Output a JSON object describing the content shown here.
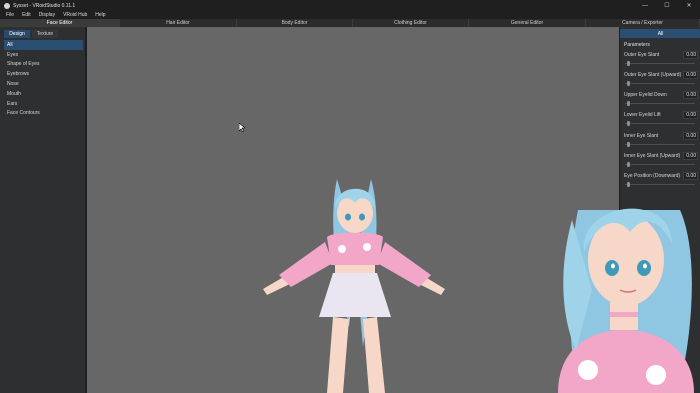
{
  "window": {
    "title": "Sysset - VRoidStudio 0.11.1"
  },
  "window_controls": {
    "minimize": "—",
    "maximize": "☐",
    "close": "✕"
  },
  "menu": [
    "File",
    "Edit",
    "Display",
    "VRoid Hub",
    "Help"
  ],
  "tabs": [
    "Face Editor",
    "Hair Editor",
    "Body Editor",
    "Clothing Editor",
    "General Editor",
    "Camera / Exporter"
  ],
  "left_panel": {
    "subtabs": [
      "Design",
      "Texture"
    ],
    "categories": [
      "All",
      "Eyes",
      "Shape of Eyes",
      "Eyebrows",
      "Nose",
      "Mouth",
      "Ears",
      "Face Contours"
    ]
  },
  "right_panel": {
    "tab": "All",
    "section_title": "Parameters",
    "params": [
      {
        "label": "Outer Eye Slant",
        "value": "0.00"
      },
      {
        "label": "Outer Eye Slant (Upward)",
        "value": "0.00"
      },
      {
        "label": "Upper Eyelid Down",
        "value": "0.00"
      },
      {
        "label": "Lower Eyelid Lift",
        "value": "0.00"
      },
      {
        "label": "Inner Eye Slant",
        "value": "0.00"
      },
      {
        "label": "Inner Eye Slant (Upward)",
        "value": "0.00"
      },
      {
        "label": "Eye Position (Downward)",
        "value": "0.00"
      }
    ]
  },
  "colors": {
    "accent": "#2b4e73",
    "viewport": "#676767",
    "hair": "#9fd3ea",
    "shirt": "#f2a6c8",
    "skirt": "#e9e6f2",
    "skin": "#f6d7c8"
  },
  "icons": {
    "app": "vroid-app-icon",
    "cursor": "mouse-pointer-icon"
  }
}
